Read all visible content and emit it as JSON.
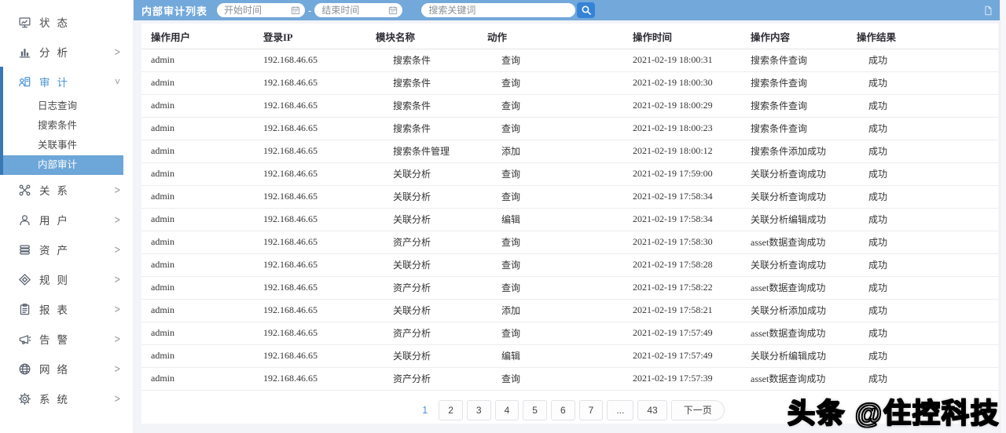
{
  "watermark": {
    "text": "头条 @住控科技"
  },
  "sidebar": {
    "items": [
      {
        "id": "status",
        "icon": "monitor-icon",
        "label": "状态"
      },
      {
        "id": "analysis",
        "icon": "chart-icon",
        "label": "分析",
        "chevron": "right"
      },
      {
        "id": "audit",
        "icon": "audit-icon",
        "label": "审计",
        "chevron": "down",
        "active_group": true,
        "children": [
          {
            "id": "log-query",
            "label": "日志查询"
          },
          {
            "id": "search-criteria",
            "label": "搜索条件"
          },
          {
            "id": "related-events",
            "label": "关联事件"
          },
          {
            "id": "internal-audit",
            "label": "内部审计",
            "selected": true
          }
        ]
      },
      {
        "id": "relations",
        "icon": "nodes-icon",
        "label": "关系",
        "chevron": "right"
      },
      {
        "id": "users",
        "icon": "user-icon",
        "label": "用户",
        "chevron": "right"
      },
      {
        "id": "assets",
        "icon": "assets-icon",
        "label": "资产",
        "chevron": "right"
      },
      {
        "id": "rules",
        "icon": "rules-icon",
        "label": "规则",
        "chevron": "right"
      },
      {
        "id": "reports",
        "icon": "report-icon",
        "label": "报表",
        "chevron": "right"
      },
      {
        "id": "alerts",
        "icon": "alert-icon",
        "label": "告警",
        "chevron": "right"
      },
      {
        "id": "network",
        "icon": "globe-icon",
        "label": "网络",
        "chevron": "right"
      },
      {
        "id": "system",
        "icon": "gear-icon",
        "label": "系统",
        "chevron": "right"
      }
    ]
  },
  "toolbar": {
    "title": "内部审计列表",
    "start_time_placeholder": "开始时间",
    "end_time_placeholder": "结束时间",
    "range_separator": "-",
    "keyword_placeholder": "搜索关键词"
  },
  "table": {
    "columns": [
      "操作用户",
      "登录IP",
      "模块名称",
      "动作",
      "操作时间",
      "操作内容",
      "操作结果"
    ],
    "rows": [
      [
        "admin",
        "192.168.46.65",
        "搜索条件",
        "查询",
        "2021-02-19 18:00:31",
        "搜索条件查询",
        "成功"
      ],
      [
        "admin",
        "192.168.46.65",
        "搜索条件",
        "查询",
        "2021-02-19 18:00:30",
        "搜索条件查询",
        "成功"
      ],
      [
        "admin",
        "192.168.46.65",
        "搜索条件",
        "查询",
        "2021-02-19 18:00:29",
        "搜索条件查询",
        "成功"
      ],
      [
        "admin",
        "192.168.46.65",
        "搜索条件",
        "查询",
        "2021-02-19 18:00:23",
        "搜索条件查询",
        "成功"
      ],
      [
        "admin",
        "192.168.46.65",
        "搜索条件管理",
        "添加",
        "2021-02-19 18:00:12",
        "搜索条件添加成功",
        "成功"
      ],
      [
        "admin",
        "192.168.46.65",
        "关联分析",
        "查询",
        "2021-02-19 17:59:00",
        "关联分析查询成功",
        "成功"
      ],
      [
        "admin",
        "192.168.46.65",
        "关联分析",
        "查询",
        "2021-02-19 17:58:34",
        "关联分析查询成功",
        "成功"
      ],
      [
        "admin",
        "192.168.46.65",
        "关联分析",
        "编辑",
        "2021-02-19 17:58:34",
        "关联分析编辑成功",
        "成功"
      ],
      [
        "admin",
        "192.168.46.65",
        "资产分析",
        "查询",
        "2021-02-19 17:58:30",
        "asset数据查询成功",
        "成功"
      ],
      [
        "admin",
        "192.168.46.65",
        "关联分析",
        "查询",
        "2021-02-19 17:58:28",
        "关联分析查询成功",
        "成功"
      ],
      [
        "admin",
        "192.168.46.65",
        "资产分析",
        "查询",
        "2021-02-19 17:58:22",
        "asset数据查询成功",
        "成功"
      ],
      [
        "admin",
        "192.168.46.65",
        "关联分析",
        "添加",
        "2021-02-19 17:58:21",
        "关联分析添加成功",
        "成功"
      ],
      [
        "admin",
        "192.168.46.65",
        "资产分析",
        "查询",
        "2021-02-19 17:57:49",
        "asset数据查询成功",
        "成功"
      ],
      [
        "admin",
        "192.168.46.65",
        "关联分析",
        "编辑",
        "2021-02-19 17:57:49",
        "关联分析编辑成功",
        "成功"
      ],
      [
        "admin",
        "192.168.46.65",
        "资产分析",
        "查询",
        "2021-02-19 17:57:39",
        "asset数据查询成功",
        "成功"
      ]
    ]
  },
  "pagination": {
    "current": "1",
    "pages": [
      "2",
      "3",
      "4",
      "5",
      "6",
      "7",
      "...",
      "43"
    ],
    "next_label": "下一页"
  },
  "colors": {
    "topbar": "#73a8da",
    "selected_item": "#6da6d8",
    "group_indicator": "#3a77b5",
    "active_text": "#4e96d9",
    "search_button": "#3583d6",
    "page_current": "#4a90d9"
  }
}
